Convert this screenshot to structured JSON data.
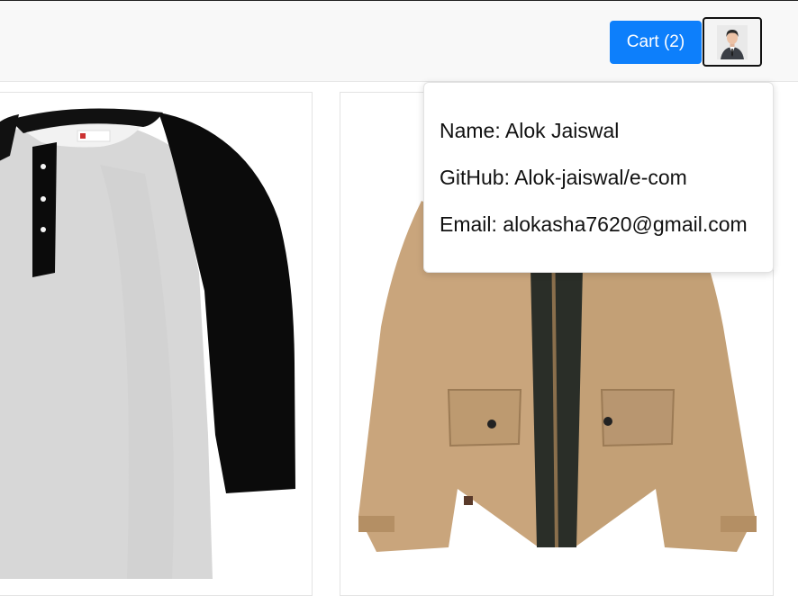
{
  "header": {
    "cart_label": "Cart (2)",
    "avatar_icon": "user-avatar-icon"
  },
  "products": [
    {
      "image": "raglan-henley-tshirt-image",
      "alt": "Grey and black raglan henley t-shirt"
    },
    {
      "image": "khaki-field-jacket-image",
      "alt": "Khaki field jacket"
    }
  ],
  "profile_popover": {
    "name": "Name: Alok Jaiswal",
    "github": "GitHub: Alok-jaiswal/e-com",
    "email": "Email: alokasha7620@gmail.com"
  },
  "colors": {
    "primary_button": "#0d7ffb",
    "header_bg": "#f8f8f8",
    "jacket": "#c9a57c",
    "shirt_body": "#d6d6d6",
    "shirt_sleeve": "#0a0a0a"
  }
}
